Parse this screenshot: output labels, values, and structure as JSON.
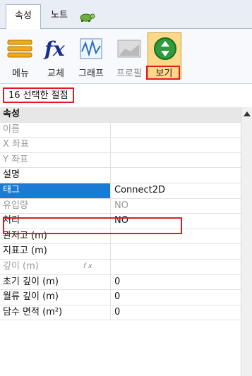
{
  "tabs": [
    {
      "label": "속성"
    },
    {
      "label": "노트"
    },
    {
      "icon": "turtle-icon"
    }
  ],
  "toolbar": {
    "buttons": [
      {
        "label": "메뉴",
        "icon": "menu-icon"
      },
      {
        "label": "교체",
        "icon": "fx-icon"
      },
      {
        "label": "그래프",
        "icon": "graph-icon"
      },
      {
        "label": "프로필",
        "icon": "profile-icon"
      },
      {
        "label": "보기",
        "icon": "view-icon"
      }
    ]
  },
  "selection": {
    "text": "16 선택한 절점"
  },
  "grid": {
    "section": "속성",
    "rows": [
      {
        "name": "이름",
        "value": ""
      },
      {
        "name": "X 좌표",
        "value": ""
      },
      {
        "name": "Y 좌표",
        "value": ""
      },
      {
        "name": "설명",
        "value": ""
      },
      {
        "name": "태그",
        "value": "Connect2D"
      },
      {
        "name": "유입량",
        "value": "NO"
      },
      {
        "name": "처리",
        "value": "NO"
      },
      {
        "name": "관저고 (m)",
        "value": ""
      },
      {
        "name": "지표고 (m)",
        "value": ""
      },
      {
        "name": "깊이 (m)",
        "value": "",
        "note": "f x"
      },
      {
        "name": "초기 깊이 (m)",
        "value": "0"
      },
      {
        "name": "월류 깊이 (m)",
        "value": "0"
      },
      {
        "name": "담수 면적 (m²)",
        "value": "0"
      }
    ]
  },
  "colors": {
    "accent": "#1a7bd4",
    "highlight": "#e01b24",
    "button_active": "#fcd889"
  }
}
